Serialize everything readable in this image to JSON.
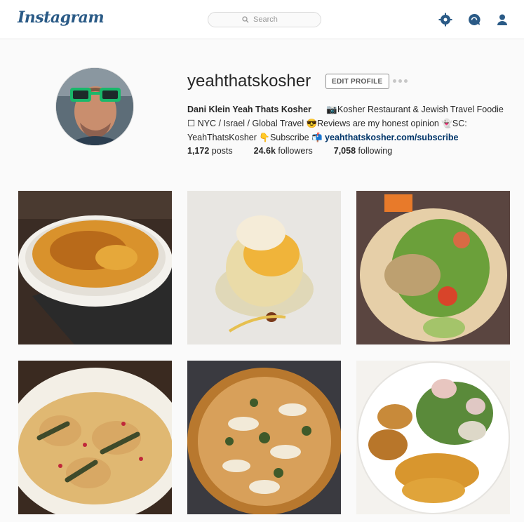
{
  "header": {
    "logo": "Instagram",
    "search": {
      "placeholder": "Search"
    },
    "icons": [
      "explore-icon",
      "activity-icon",
      "profile-icon"
    ]
  },
  "profile": {
    "username": "yeahthatskosher",
    "edit_label": "EDIT PROFILE",
    "full_name": "Dani Klein Yeah Thats Kosher",
    "bio_part1": "📷Kosher Restaurant & Jewish Travel Foodie ☐ NYC / Israel / Global Travel 😎Reviews are my honest opinion 👻SC: YeahThatsKosher 👇Subscribe 📬 ",
    "bio_link": "yeahthatskosher.com/subscribe",
    "stats": {
      "posts_count": "1,172",
      "posts_label": "posts",
      "followers_count": "24.6k",
      "followers_label": "followers",
      "following_count": "7,058",
      "following_label": "following"
    }
  },
  "posts": [
    {
      "name": "creme-brulee"
    },
    {
      "name": "dessert-cake"
    },
    {
      "name": "pita-sandwich"
    },
    {
      "name": "ravioli"
    },
    {
      "name": "pizza"
    },
    {
      "name": "salad-bowl"
    }
  ],
  "colors": {
    "brand": "#2a5a86",
    "nav_icon": "#2a5a86",
    "link": "#003569"
  }
}
